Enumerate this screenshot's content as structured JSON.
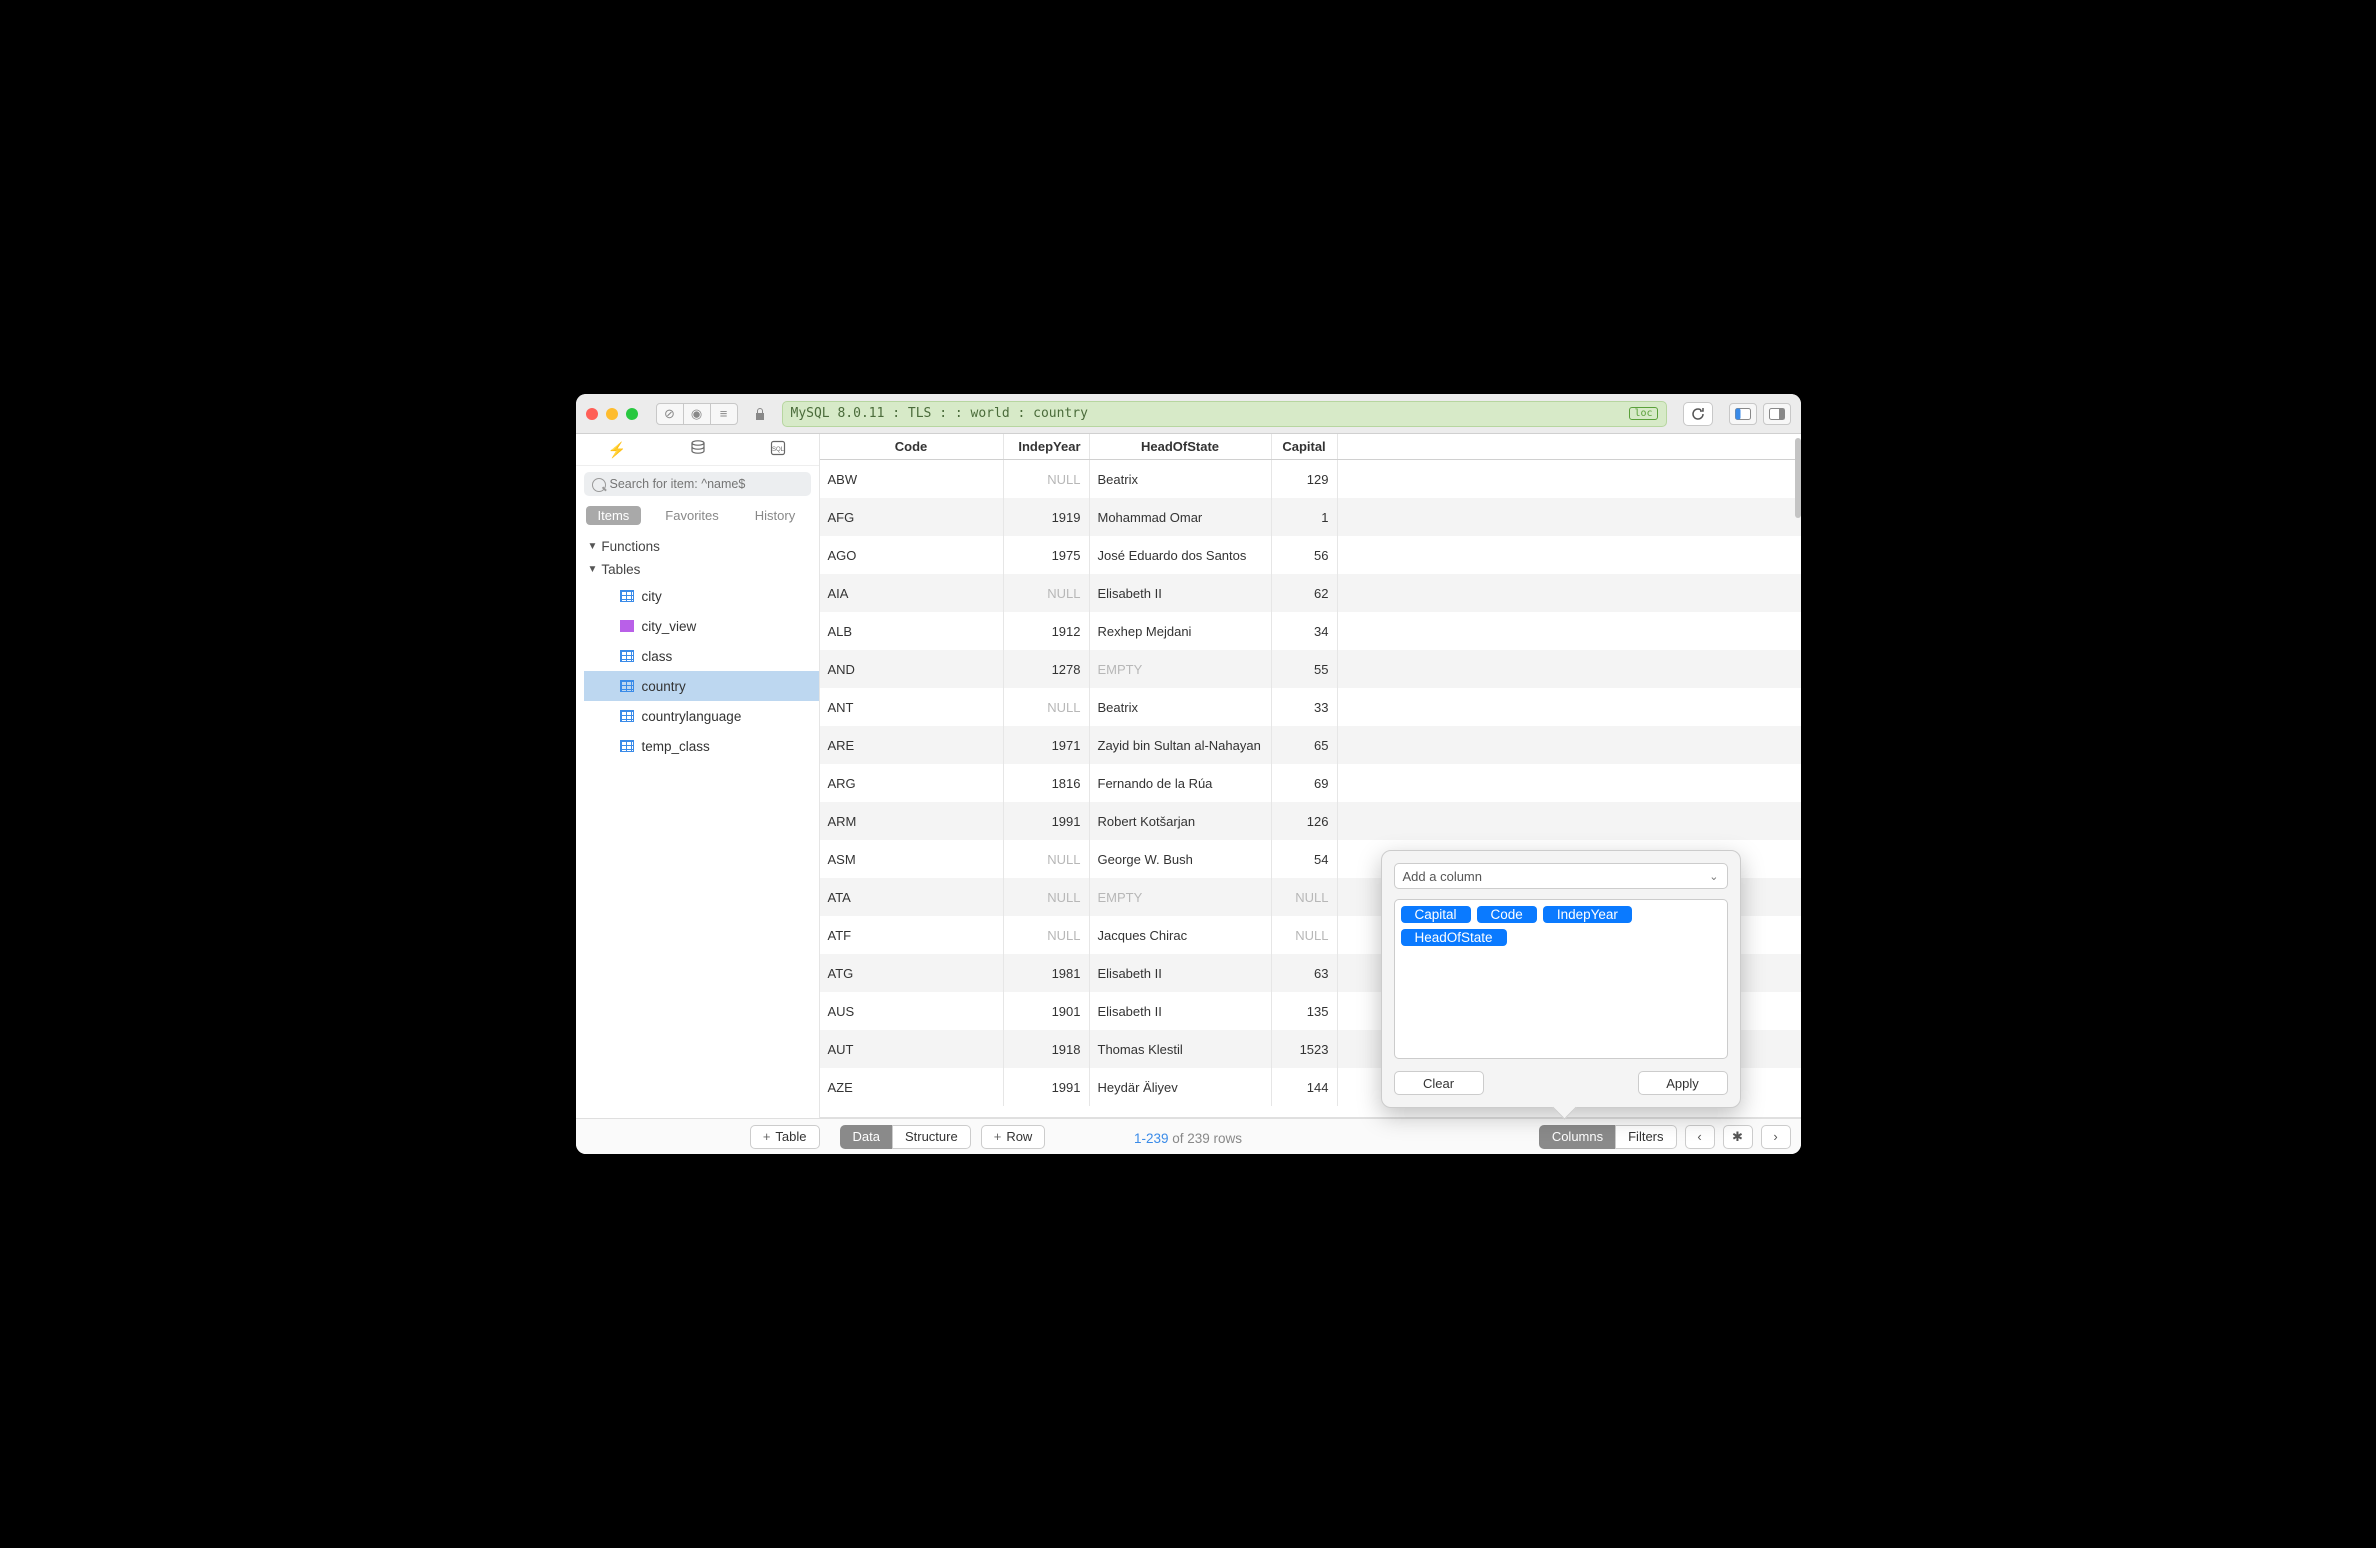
{
  "titlebar": {
    "connection_string": "MySQL 8.0.11 : TLS :  : world : country",
    "loc_badge": "loc"
  },
  "sidebar": {
    "search_placeholder": "Search for item: ^name$",
    "tabs": {
      "items": "Items",
      "favorites": "Favorites",
      "history": "History"
    },
    "sections": {
      "functions_label": "Functions",
      "tables_label": "Tables"
    },
    "tables": [
      {
        "name": "city",
        "type": "table"
      },
      {
        "name": "city_view",
        "type": "view"
      },
      {
        "name": "class",
        "type": "table"
      },
      {
        "name": "country",
        "type": "table",
        "selected": true
      },
      {
        "name": "countrylanguage",
        "type": "table"
      },
      {
        "name": "temp_class",
        "type": "table"
      }
    ],
    "add_table_label": "Table"
  },
  "grid": {
    "columns": [
      "Code",
      "IndepYear",
      "HeadOfState",
      "Capital"
    ],
    "rows": [
      {
        "code": "ABW",
        "indep": null,
        "head": "Beatrix",
        "capital": "129"
      },
      {
        "code": "AFG",
        "indep": "1919",
        "head": "Mohammad Omar",
        "capital": "1"
      },
      {
        "code": "AGO",
        "indep": "1975",
        "head": "José Eduardo dos Santos",
        "capital": "56"
      },
      {
        "code": "AIA",
        "indep": null,
        "head": "Elisabeth II",
        "capital": "62"
      },
      {
        "code": "ALB",
        "indep": "1912",
        "head": "Rexhep Mejdani",
        "capital": "34"
      },
      {
        "code": "AND",
        "indep": "1278",
        "head": "",
        "capital": "55"
      },
      {
        "code": "ANT",
        "indep": null,
        "head": "Beatrix",
        "capital": "33"
      },
      {
        "code": "ARE",
        "indep": "1971",
        "head": "Zayid bin Sultan al-Nahayan",
        "capital": "65"
      },
      {
        "code": "ARG",
        "indep": "1816",
        "head": "Fernando de la Rúa",
        "capital": "69"
      },
      {
        "code": "ARM",
        "indep": "1991",
        "head": "Robert Kotšarjan",
        "capital": "126"
      },
      {
        "code": "ASM",
        "indep": null,
        "head": "George W. Bush",
        "capital": "54"
      },
      {
        "code": "ATA",
        "indep": null,
        "head": "",
        "capital": null
      },
      {
        "code": "ATF",
        "indep": null,
        "head": "Jacques Chirac",
        "capital": null
      },
      {
        "code": "ATG",
        "indep": "1981",
        "head": "Elisabeth II",
        "capital": "63"
      },
      {
        "code": "AUS",
        "indep": "1901",
        "head": "Elisabeth II",
        "capital": "135"
      },
      {
        "code": "AUT",
        "indep": "1918",
        "head": "Thomas Klestil",
        "capital": "1523"
      },
      {
        "code": "AZE",
        "indep": "1991",
        "head": "Heydär Äliyev",
        "capital": "144"
      }
    ],
    "null_label": "NULL",
    "empty_label": "EMPTY"
  },
  "bottombar": {
    "data_label": "Data",
    "structure_label": "Structure",
    "add_row_label": "Row",
    "status_range": "1-239",
    "status_of": " of 239 rows",
    "columns_label": "Columns",
    "filters_label": "Filters"
  },
  "popover": {
    "add_placeholder": "Add a column",
    "tags": [
      "Capital",
      "Code",
      "IndepYear",
      "HeadOfState"
    ],
    "clear_label": "Clear",
    "apply_label": "Apply"
  }
}
